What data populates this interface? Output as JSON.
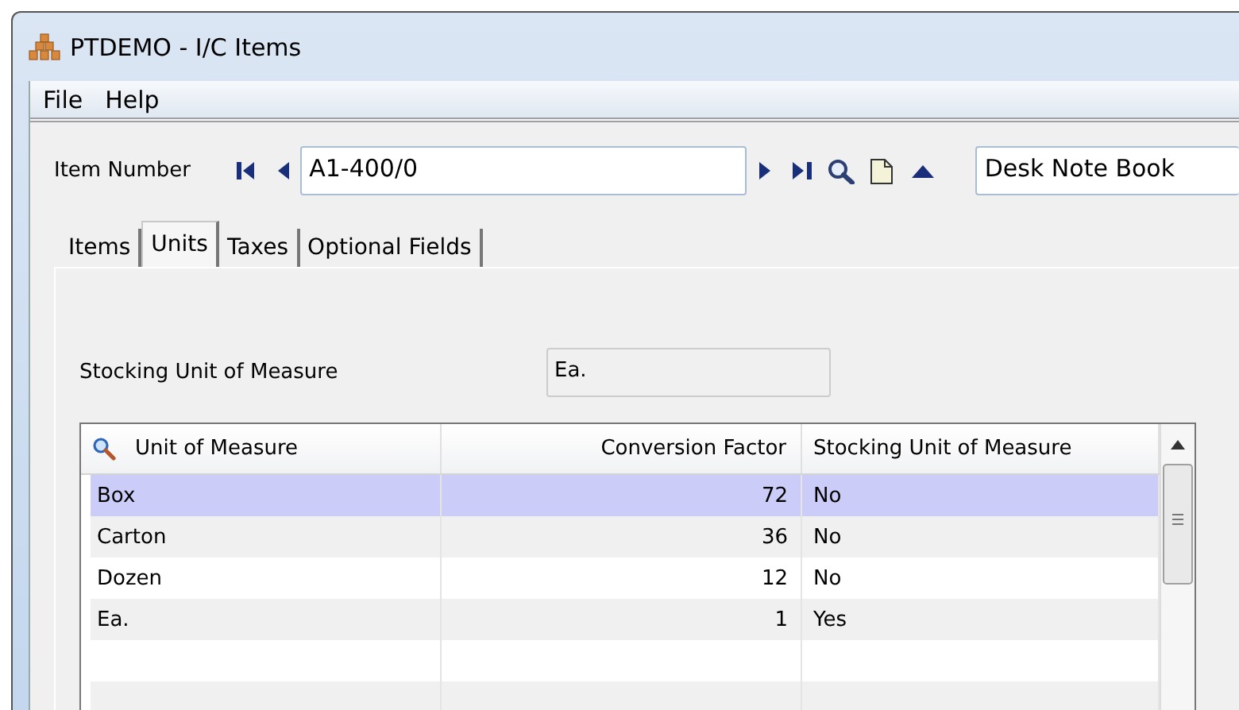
{
  "window": {
    "title": "PTDEMO - I/C Items"
  },
  "menu": [
    {
      "label": "File"
    },
    {
      "label": "Help"
    }
  ],
  "item_number": {
    "label": "Item Number",
    "value": "A1-400/0",
    "description": "Desk Note Book"
  },
  "tabs": [
    {
      "label": "Items",
      "selected": false
    },
    {
      "label": "Units",
      "selected": true
    },
    {
      "label": "Taxes",
      "selected": false
    },
    {
      "label": "Optional Fields",
      "selected": false
    }
  ],
  "stocking_unit": {
    "label": "Stocking Unit of Measure",
    "value": "Ea."
  },
  "table": {
    "columns": [
      "Unit of Measure",
      "Conversion Factor",
      "Stocking Unit of Measure"
    ],
    "rows": [
      {
        "cells": [
          "Box",
          "72",
          "No"
        ],
        "selected": true
      },
      {
        "cells": [
          "Carton",
          "36",
          "No"
        ],
        "selected": false
      },
      {
        "cells": [
          "Dozen",
          "12",
          "No"
        ],
        "selected": false
      },
      {
        "cells": [
          "Ea.",
          "1",
          "Yes"
        ],
        "selected": false
      }
    ]
  }
}
